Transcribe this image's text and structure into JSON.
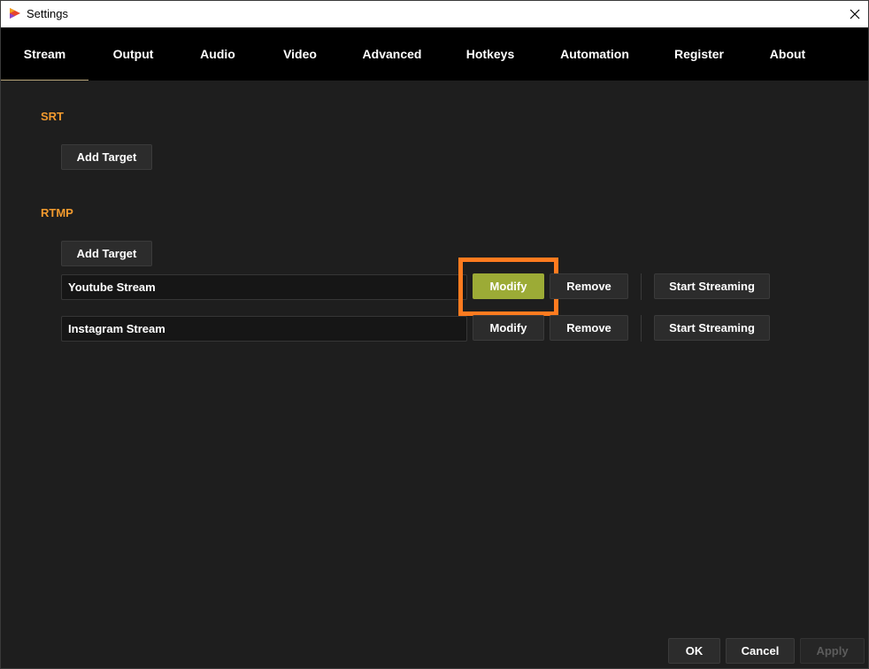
{
  "window": {
    "title": "Settings"
  },
  "tabs": [
    {
      "label": "Stream",
      "active": true
    },
    {
      "label": "Output"
    },
    {
      "label": "Audio"
    },
    {
      "label": "Video"
    },
    {
      "label": "Advanced"
    },
    {
      "label": "Hotkeys"
    },
    {
      "label": "Automation"
    },
    {
      "label": "Register"
    },
    {
      "label": "About"
    }
  ],
  "srt": {
    "title": "SRT",
    "add_target": "Add Target"
  },
  "rtmp": {
    "title": "RTMP",
    "add_target": "Add Target",
    "targets": [
      {
        "name": "Youtube Stream",
        "modify": "Modify",
        "remove": "Remove",
        "start": "Start Streaming"
      },
      {
        "name": "Instagram Stream",
        "modify": "Modify",
        "remove": "Remove",
        "start": "Start Streaming"
      }
    ]
  },
  "footer": {
    "ok": "OK",
    "cancel": "Cancel",
    "apply": "Apply"
  },
  "colors": {
    "accent_orange": "#f29a2e",
    "highlight_orange": "#ff7b1f",
    "modify_green": "#9cab36",
    "background": "#1e1e1e",
    "tabbar": "#000000"
  }
}
